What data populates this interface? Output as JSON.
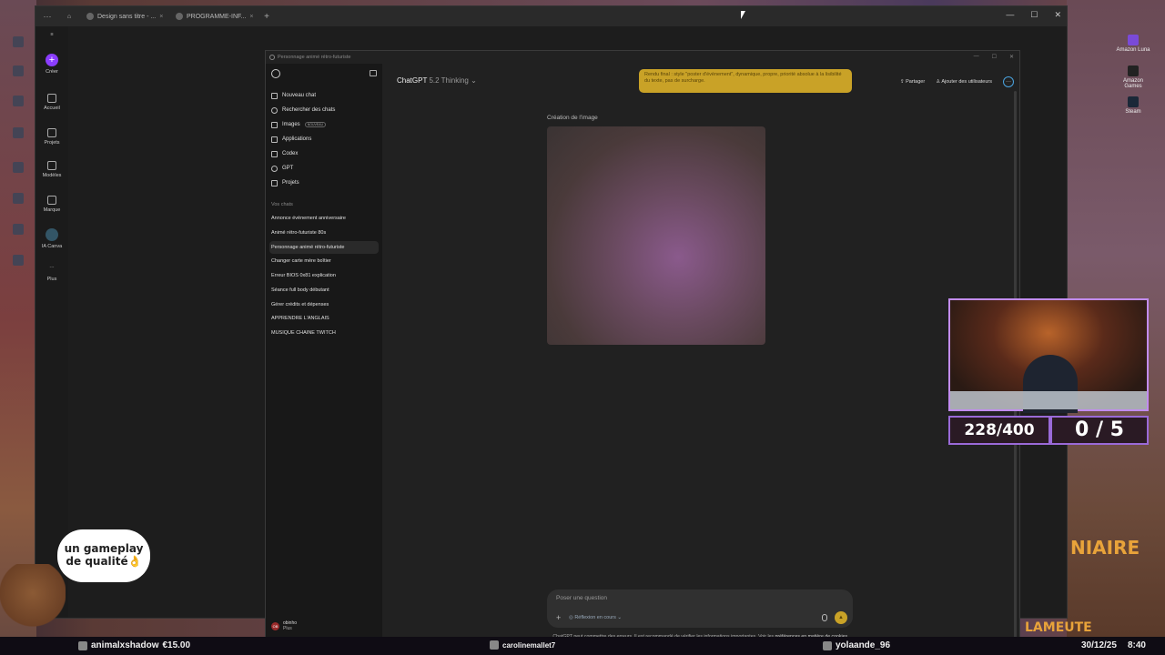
{
  "browser": {
    "tabs": [
      {
        "label": "Design sans titre - ..."
      },
      {
        "label": "PROGRAMME-INF..."
      }
    ]
  },
  "desktop_right": {
    "icons": [
      "Amazon Luna",
      "Amazon Games",
      "Steam"
    ]
  },
  "canva_sidebar": {
    "items": [
      "Créer",
      "Accueil",
      "Projets",
      "Modèles",
      "Marque",
      "IA Canva",
      "Plus"
    ]
  },
  "chatgpt": {
    "window_title": "Personnage animé rétro-futuriste",
    "nav": {
      "new_chat": "Nouveau chat",
      "search": "Rechercher des chats",
      "images": "Images",
      "images_badge": "NOUVEAU",
      "apps": "Applications",
      "codex": "Codex",
      "gpt": "GPT",
      "projects": "Projets"
    },
    "chats_heading": "Vos chats",
    "chats": [
      "Annonce évènement anniversaire",
      "Animé rétro-futuriste 80s",
      "Personnage animé rétro-futuriste",
      "Changer carte mère boîtier",
      "Erreur BIOS 0x81 explication",
      "Séance full body débutant",
      "Gérer crédits et dépenses",
      "APPRENDRE L'ANGLAIS",
      "MUSIQUE CHAINE TWITCH"
    ],
    "user": {
      "name": "obinho",
      "plan": "Plus",
      "initials": "OB"
    },
    "model": {
      "name": "ChatGPT",
      "version": "5.2 Thinking"
    },
    "prompt_text": "Rendu final : style \"poster d'évènement\", dynamique, propre, priorité absolue à la lisibilité du texte, pas de surcharge.",
    "share": "Partager",
    "add_users": "Ajouter des utilisateurs",
    "image_label": "Création de l'image",
    "composer_placeholder": "Poser une question",
    "reflection": "Réflexion en cours",
    "disclaimer": "ChatGPT peut commettre des erreurs. Il est recommandé de vérifier les informations importantes. Voir les",
    "disclaimer_link": "préférences en matière de cookies."
  },
  "overlay": {
    "counter_left": "228/400",
    "counter_right": "0 / 5",
    "bubble_text": "un gameplay de qualité👌",
    "brand": "NIAIRE",
    "brand2": "LAMEUTE"
  },
  "ticker": {
    "donation_user": "animalxshadow",
    "donation_amount": "€15.00",
    "follower": "carolinemallet7",
    "sub": "yolaande_96",
    "date": "30/12/25",
    "time": "8:40"
  }
}
